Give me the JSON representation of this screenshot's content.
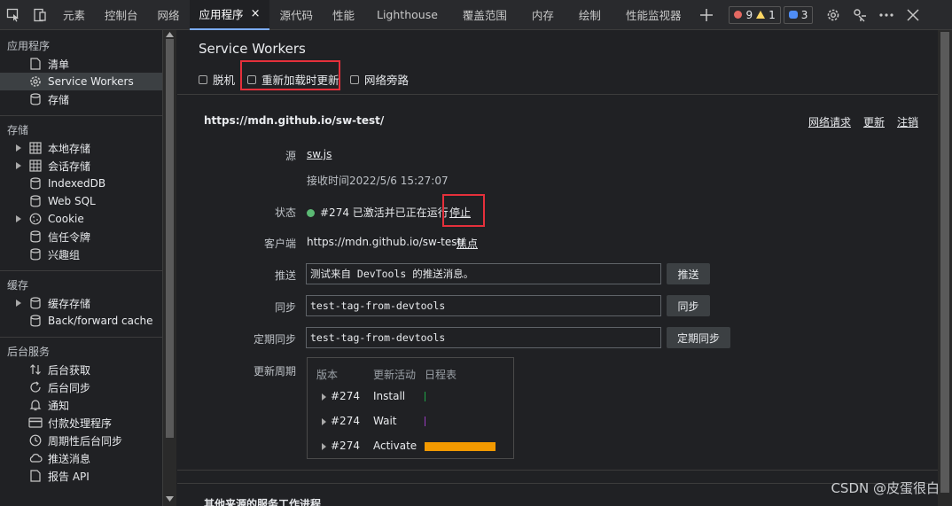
{
  "toolbar": {
    "tabs": [
      {
        "label": "元素"
      },
      {
        "label": "控制台"
      },
      {
        "label": "网络"
      },
      {
        "label": "应用程序",
        "active": true
      },
      {
        "label": "源代码"
      },
      {
        "label": "性能"
      },
      {
        "label": "Lighthouse"
      },
      {
        "label": "覆盖范围"
      },
      {
        "label": "内存"
      },
      {
        "label": "绘制"
      },
      {
        "label": "性能监视器"
      }
    ],
    "errors": "9",
    "warnings": "1",
    "messages": "3",
    "close_tab_glyph": "×"
  },
  "sidebar": {
    "sections": {
      "application": "应用程序",
      "storage": "存储",
      "cache": "缓存",
      "background": "后台服务"
    },
    "app_items": [
      "清单",
      "Service Workers",
      "存储"
    ],
    "storage_items": [
      "本地存储",
      "会话存储",
      "IndexedDB",
      "Web SQL",
      "Cookie",
      "信任令牌",
      "兴趣组"
    ],
    "cache_items": [
      "缓存存储",
      "Back/forward cache"
    ],
    "background_items": [
      "后台获取",
      "后台同步",
      "通知",
      "付款处理程序",
      "周期性后台同步",
      "推送消息",
      "报告 API"
    ]
  },
  "main": {
    "title": "Service Workers",
    "checkboxes": {
      "offline": "脱机",
      "update_on_reload": "重新加载时更新",
      "bypass": "网络旁路"
    },
    "scope": "https://mdn.github.io/sw-test/",
    "scope_links": {
      "network": "网络请求",
      "update": "更新",
      "unregister": "注销"
    },
    "labels": {
      "source": "源",
      "status": "状态",
      "client": "客户端",
      "push": "推送",
      "sync": "同步",
      "periodic_sync": "定期同步",
      "update_cycle": "更新周期"
    },
    "source_file": "sw.js",
    "received": "接收时间2022/5/6 15:27:07",
    "status_text": "#274 已激活并已正在运行",
    "stop_link": "停止",
    "client_url": "https://mdn.github.io/sw-test/",
    "focus_link": "焦点",
    "push_value": "测试来自 DevTools 的推送消息。",
    "push_button": "推送",
    "sync_value": "test-tag-from-devtools",
    "sync_button": "同步",
    "periodic_value": "test-tag-from-devtools",
    "periodic_button": "定期同步",
    "timeline": {
      "headers": [
        "版本",
        "更新活动",
        "日程表"
      ],
      "rows": [
        {
          "version": "#274",
          "activity": "Install",
          "color": "#1ea446"
        },
        {
          "version": "#274",
          "activity": "Wait",
          "color": "#9b3bc0"
        },
        {
          "version": "#274",
          "activity": "Activate",
          "color": "#f29900"
        }
      ]
    },
    "other_origins_title": "其他来源的服务工作进程"
  },
  "watermark": "CSDN @皮蛋很白"
}
